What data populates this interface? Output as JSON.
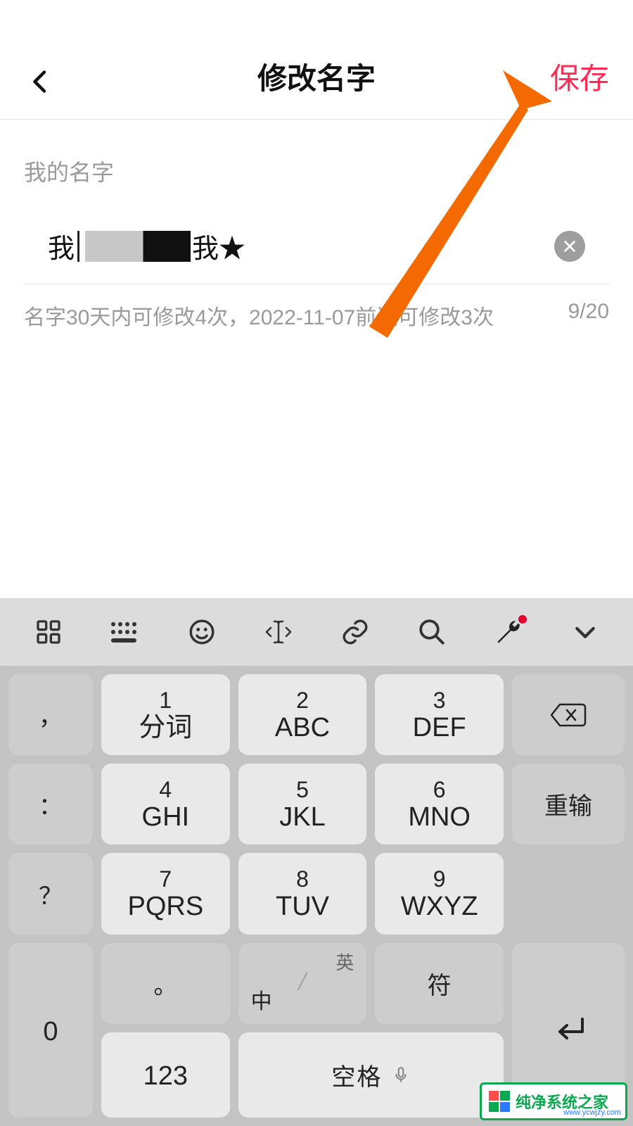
{
  "header": {
    "title": "修改名字",
    "save_label": "保存"
  },
  "form": {
    "section_label": "我的名字",
    "value_prefix": "我",
    "value_suffix": "我★",
    "hint": "名字30天内可修改4次，2022-11-07前还可修改3次",
    "counter": "9/20"
  },
  "keyboard": {
    "side": {
      "comma": "，",
      "colon": "：",
      "question": "？",
      "ring": "。",
      "sym": "符"
    },
    "pad": [
      {
        "num": "1",
        "let": "分词"
      },
      {
        "num": "2",
        "let": "ABC"
      },
      {
        "num": "3",
        "let": "DEF"
      },
      {
        "num": "4",
        "let": "GHI"
      },
      {
        "num": "5",
        "let": "JKL"
      },
      {
        "num": "6",
        "let": "MNO"
      },
      {
        "num": "7",
        "let": "PQRS"
      },
      {
        "num": "8",
        "let": "TUV"
      },
      {
        "num": "9",
        "let": "WXYZ"
      }
    ],
    "right": {
      "redo": "重输",
      "zero": "0"
    },
    "bottom": {
      "num_mode": "123",
      "space": "空格",
      "lang_top": "英",
      "lang_bottom": "中"
    }
  },
  "watermark": {
    "brand": "纯净系统之家",
    "url": "www.ycwjzy.com"
  }
}
